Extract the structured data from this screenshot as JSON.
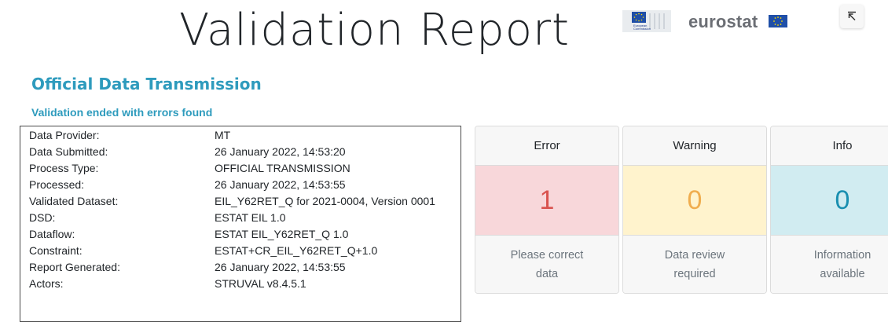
{
  "header": {
    "title": "Validation Report",
    "logo": {
      "ec_caption_line1": "European",
      "ec_caption_line2": "Commission",
      "eurostat_text": "eurostat"
    },
    "collapse_icon": "arrow-up-left-icon"
  },
  "section": {
    "title": "Official Data Transmission",
    "subtitle": "Validation ended with errors found"
  },
  "info": {
    "rows": [
      {
        "label": "Data Provider:",
        "value": "MT"
      },
      {
        "label": "Data Submitted:",
        "value": "26 January 2022, 14:53:20"
      },
      {
        "label": "Process Type:",
        "value": "OFFICIAL TRANSMISSION"
      },
      {
        "label": "Processed:",
        "value": "26 January 2022, 14:53:55"
      },
      {
        "label": "Validated Dataset:",
        "value": "EIL_Y62RET_Q for 2021-0004, Version 0001"
      },
      {
        "label": "DSD:",
        "value": "ESTAT EIL 1.0"
      },
      {
        "label": "Dataflow:",
        "value": "ESTAT EIL_Y62RET_Q 1.0"
      },
      {
        "label": "Constraint:",
        "value": "ESTAT+CR_EIL_Y62RET_Q+1.0"
      },
      {
        "label": "Report Generated:",
        "value": "26 January 2022, 14:53:55"
      },
      {
        "label": "Actors:",
        "value": "STRUVAL v8.4.5.1"
      }
    ]
  },
  "cards": [
    {
      "title": "Error",
      "count": "1",
      "note": "Please correct data",
      "bg": "#f8d7da",
      "fg": "#d9534f"
    },
    {
      "title": "Warning",
      "count": "0",
      "note": "Data review required",
      "bg": "#fff3cd",
      "fg": "#f0ad4e"
    },
    {
      "title": "Info",
      "count": "0",
      "note": "Information available",
      "bg": "#d1ecf1",
      "fg": "#1a8fb0"
    }
  ],
  "colors": {
    "accent": "#2e9bbd",
    "eurostat_grey": "#6b6e74",
    "eu_blue": "#1f4fa8",
    "eu_gold": "#ffdd00"
  }
}
